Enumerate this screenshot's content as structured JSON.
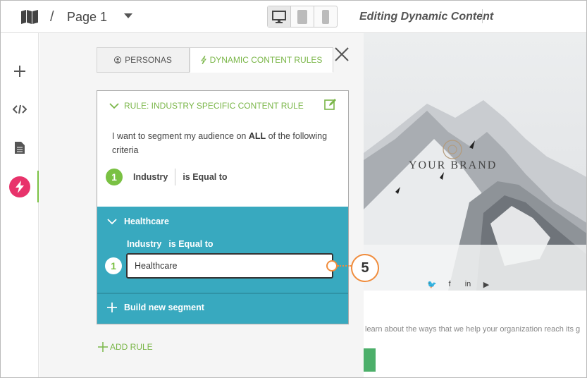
{
  "topbar": {
    "separator": "/",
    "page_name": "Page 1",
    "editing_label": "Editing Dynamic Content"
  },
  "tabs": {
    "personas": "PERSONAS",
    "dynamic_rules": "DYNAMIC CONTENT RULES"
  },
  "rule": {
    "title": "RULE: INDUSTRY SPECIFIC CONTENT RULE",
    "desc_pre": "I want to segment my audience on ",
    "desc_bold": "ALL",
    "desc_post": " of the following criteria",
    "criteria": {
      "number": "1",
      "field": "Industry",
      "operator": "is Equal to"
    }
  },
  "segment": {
    "name": "Healthcare",
    "criteria_field": "Industry",
    "criteria_operator": "is Equal to",
    "number": "1",
    "value": "Healthcare",
    "build_new": "Build new segment"
  },
  "add_rule": "ADD RULE",
  "callout": "5",
  "preview": {
    "brand": "YOUR BRAND",
    "body_text": "learn about the ways that we help your organization reach its g"
  },
  "colors": {
    "accent_green": "#7ac143",
    "segment_teal": "#38a9bf",
    "bolt_pink": "#e8336b",
    "callout_orange": "#f08c3c"
  }
}
